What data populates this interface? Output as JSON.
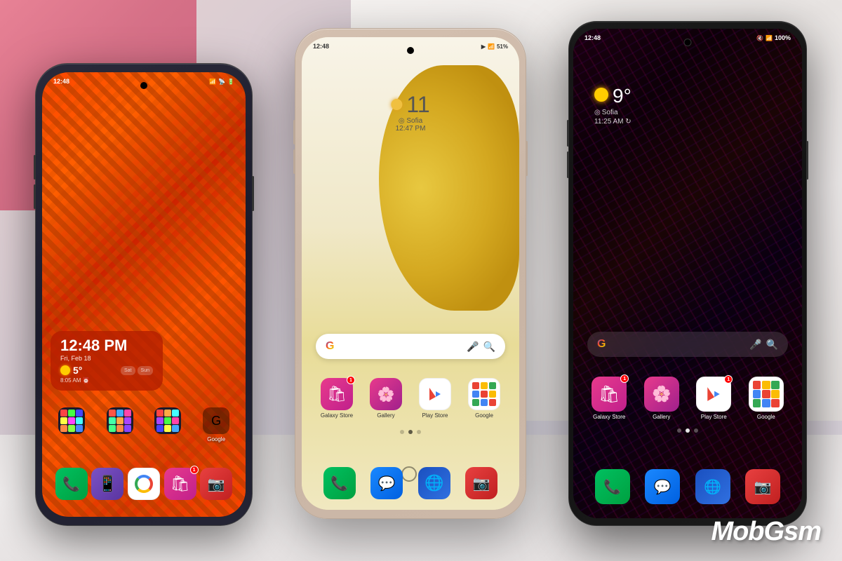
{
  "scene": {
    "watermark": "MobGsm"
  },
  "phone1": {
    "status": {
      "time": "12:48",
      "icons": "📶🔋"
    },
    "clock": {
      "time": "12:48 PM",
      "date": "Fri, Feb 18",
      "temp": "5°",
      "alarm": "8:05 AM ⏰"
    },
    "calendar": {
      "sat": "Sat",
      "sun": "Sun"
    },
    "apps": {
      "dock": [
        "Phone",
        "Viber",
        "Chrome",
        "Galaxy Store",
        "Camera"
      ]
    }
  },
  "phone2": {
    "status": {
      "time": "12:48",
      "battery": "51%"
    },
    "date_widget": {
      "number": "11",
      "location": "◎ Sofia",
      "time": "12:47 PM"
    },
    "apps": {
      "row1": [
        "Galaxy Store",
        "Gallery",
        "Play Store",
        "Google"
      ],
      "dock": [
        "Phone",
        "Messages",
        "Samsung Internet",
        "Camera"
      ]
    }
  },
  "phone3": {
    "status": {
      "time": "12:48",
      "battery": "100%"
    },
    "weather": {
      "temp": "9°",
      "location": "Sofia",
      "time": "11:25 AM ↻"
    },
    "apps": {
      "row1": [
        "Galaxy Store",
        "Gallery",
        "Play Store",
        "Google"
      ],
      "dock": [
        "Phone",
        "Messages",
        "Samsung Internet",
        "Camera"
      ]
    }
  }
}
